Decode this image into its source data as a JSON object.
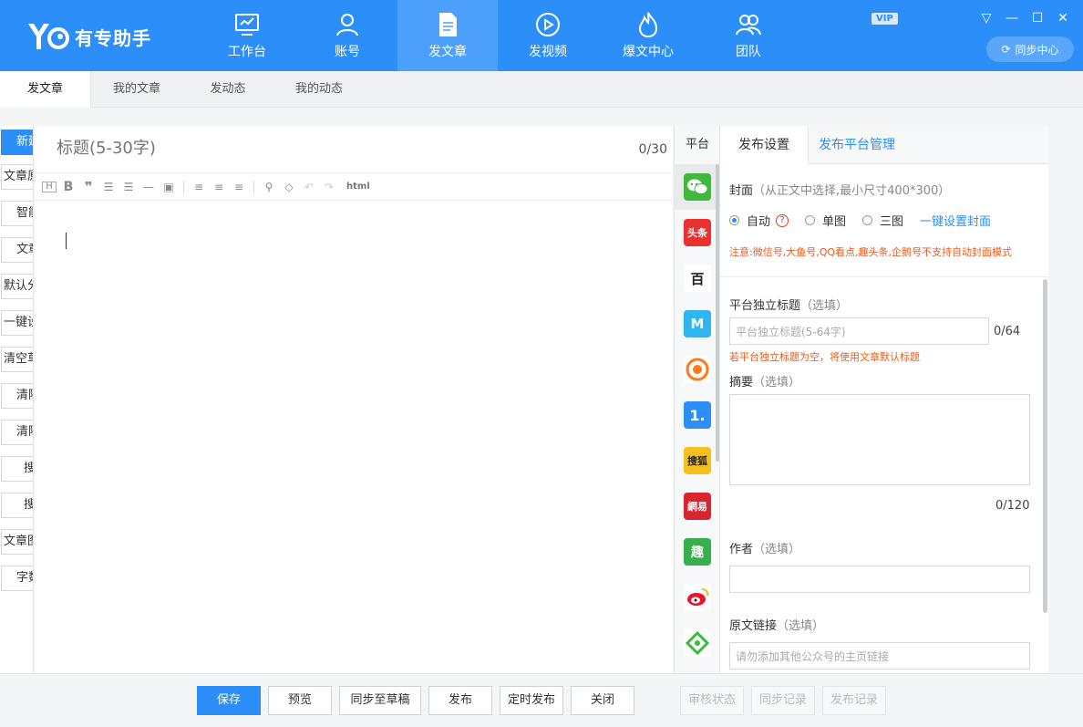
{
  "app": {
    "name": "有专助手",
    "vip": "VIP",
    "sync_center": "同步中心"
  },
  "nav": [
    {
      "label": "工作台",
      "icon": "monitor-icon"
    },
    {
      "label": "账号",
      "icon": "user-icon"
    },
    {
      "label": "发文章",
      "icon": "document-icon"
    },
    {
      "label": "发视频",
      "icon": "play-icon"
    },
    {
      "label": "爆文中心",
      "icon": "fire-icon"
    },
    {
      "label": "团队",
      "icon": "team-icon"
    }
  ],
  "tabs": [
    "发文章",
    "我的文章",
    "发动态",
    "我的动态"
  ],
  "left_buttons": [
    "新建",
    "文章原",
    "智能",
    "文章",
    "默认分",
    "一键设",
    "清空草",
    "清除",
    "清除",
    "搜",
    "搜",
    "文章图",
    "字数"
  ],
  "editor": {
    "title_placeholder": "标题(5-30字)",
    "title_count": "0/30",
    "toolbar_html": "html"
  },
  "platform": {
    "header": "平台",
    "icons": [
      {
        "name": "wechat-icon",
        "label": "",
        "color": "#3fb83e"
      },
      {
        "name": "toutiao-icon",
        "label": "头条",
        "color": "#e8322f"
      },
      {
        "name": "baijiahao-icon",
        "label": "百",
        "color": "#ffffff"
      },
      {
        "name": "dayu-icon",
        "label": "M",
        "color": "#2fb5f0"
      },
      {
        "name": "qq-kandian-icon",
        "label": "",
        "color": "#ff7a1a"
      },
      {
        "name": "yidian-icon",
        "label": "1.",
        "color": "#2c8ef8"
      },
      {
        "name": "sohu-icon",
        "label": "搜狐",
        "color": "#f5c21d"
      },
      {
        "name": "netease-icon",
        "label": "網易",
        "color": "#d8252f"
      },
      {
        "name": "qutoutiao-icon",
        "label": "趣",
        "color": "#35b04a"
      },
      {
        "name": "weibo-icon",
        "label": "",
        "color": "#f5b622"
      },
      {
        "name": "iqiyi-icon",
        "label": "",
        "color": "#ffffff"
      }
    ]
  },
  "settings": {
    "tab_active": "发布设置",
    "tab_manage": "发布平台管理",
    "cover_label": "封面",
    "cover_hint": "（从正文中选择,最小尺寸400*300）",
    "radio_auto": "自动",
    "radio_single": "单图",
    "radio_three": "三图",
    "one_click_cover": "一键设置封面",
    "cover_warning": "注意:微信号,大鱼号,QQ看点,趣头条,企鹅号不支持自动封面模式",
    "indep_title_label": "平台独立标题",
    "optional": "（选填）",
    "indep_title_placeholder": "平台独立标题(5-64字)",
    "indep_title_count": "0/64",
    "indep_title_warning": "若平台独立标题为空，将使用文章默认标题",
    "summary_label": "摘要",
    "summary_count": "0/120",
    "author_label": "作者",
    "source_label": "原文链接",
    "source_placeholder": "请勿添加其他公众号的主页链接"
  },
  "bottom": {
    "save": "保存",
    "preview": "预览",
    "sync_draft": "同步至草稿",
    "publish": "发布",
    "scheduled": "定时发布",
    "close": "关闭",
    "review_status": "审核状态",
    "sync_record": "同步记录",
    "publish_record": "发布记录"
  }
}
